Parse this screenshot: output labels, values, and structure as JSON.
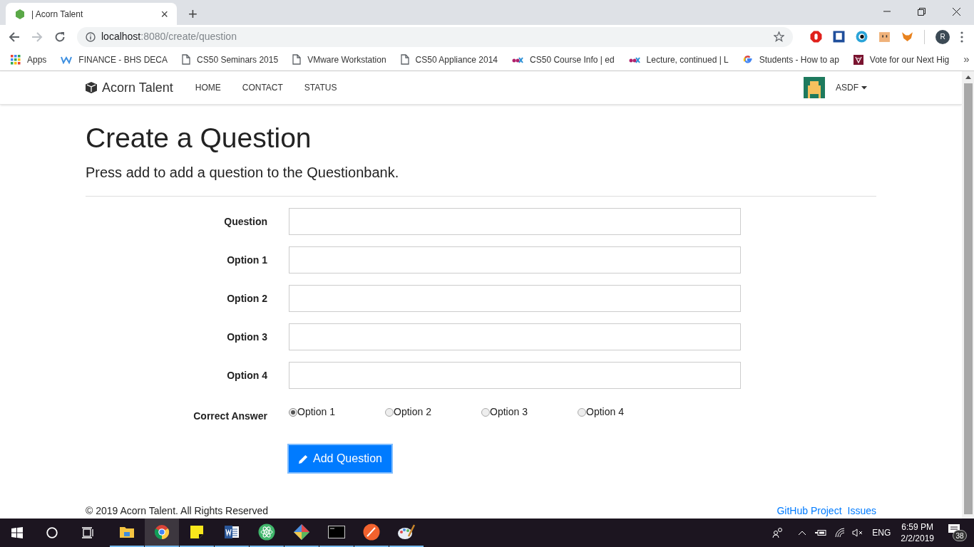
{
  "browser": {
    "tab_title": "| Acorn Talent",
    "tab_close": "×",
    "new_tab": "+",
    "url_host": "localhost",
    "url_rest": ":8080/create/question",
    "profile_initial": "R",
    "bookmarks": [
      {
        "kind": "apps",
        "label": "Apps"
      },
      {
        "kind": "w",
        "label": "FINANCE - BHS DECA"
      },
      {
        "kind": "page",
        "label": "CS50 Seminars 2015"
      },
      {
        "kind": "page",
        "label": "VMware Workstation"
      },
      {
        "kind": "page",
        "label": "CS50 Appliance 2014"
      },
      {
        "kind": "edx",
        "label": "CS50 Course Info | ed"
      },
      {
        "kind": "edx",
        "label": "Lecture, continued | L"
      },
      {
        "kind": "google",
        "label": "Students - How to ap"
      },
      {
        "kind": "crest",
        "label": "Vote for our Next Hig"
      }
    ],
    "more": "»"
  },
  "navbar": {
    "brand": "Acorn Talent",
    "links": [
      "HOME",
      "CONTACT",
      "STATUS"
    ],
    "user": "ASDF"
  },
  "page": {
    "title": "Create a Question",
    "subtitle": "Press add to add a question to the Questionbank.",
    "fields": [
      {
        "label": "Question"
      },
      {
        "label": "Option 1"
      },
      {
        "label": "Option 2"
      },
      {
        "label": "Option 3"
      },
      {
        "label": "Option 4"
      }
    ],
    "correct_answer": {
      "label": "Correct Answer",
      "options": [
        {
          "label": "Option 1",
          "selected": true
        },
        {
          "label": "Option 2",
          "selected": false
        },
        {
          "label": "Option 3",
          "selected": false
        },
        {
          "label": "Option 4",
          "selected": false
        }
      ]
    },
    "submit": "Add Question"
  },
  "footer": {
    "copyright": "© 2019 Acorn Talent. All Rights Reserved",
    "links": [
      "GitHub Project",
      "Issues"
    ]
  },
  "taskbar": {
    "apps": [
      {
        "kind": "explorer",
        "selected": false
      },
      {
        "kind": "chrome",
        "selected": true
      },
      {
        "kind": "sticky",
        "selected": false
      },
      {
        "kind": "word",
        "selected": false
      },
      {
        "kind": "atom",
        "selected": false
      },
      {
        "kind": "git",
        "selected": false
      },
      {
        "kind": "terminal",
        "selected": false
      },
      {
        "kind": "paw",
        "selected": false
      },
      {
        "kind": "paint",
        "selected": false
      }
    ],
    "language": "ENG",
    "time": "6:59 PM",
    "date": "2/2/2019",
    "notifications": "38"
  }
}
